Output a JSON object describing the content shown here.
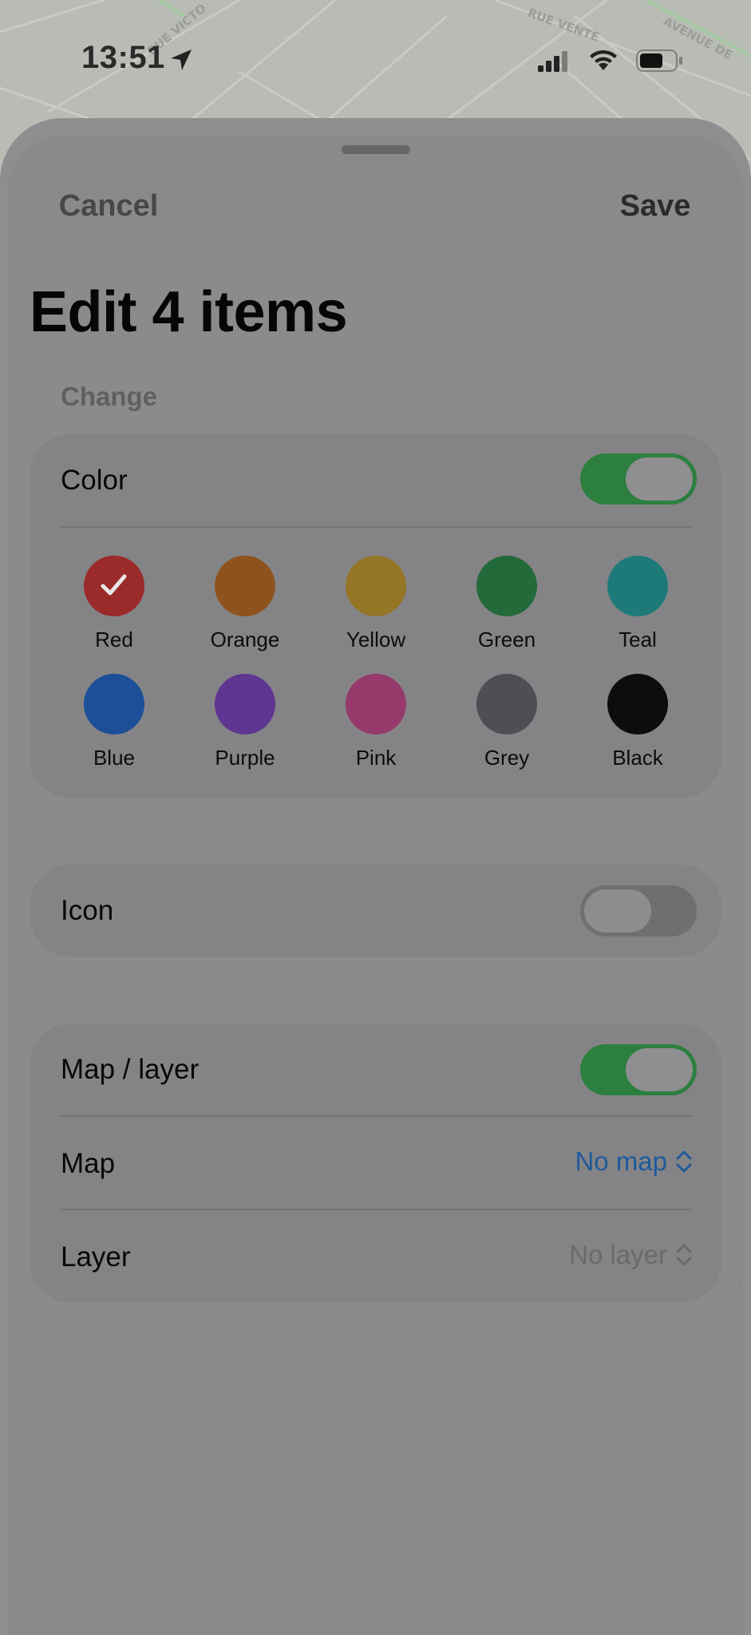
{
  "status_bar": {
    "time": "13:51",
    "icons": [
      "location-arrow-icon",
      "cellular-signal-icon",
      "wifi-icon",
      "battery-icon"
    ]
  },
  "background_map": {
    "street_labels": [
      "RUE VICTO",
      "RUE VENTE",
      "AVENUE DE"
    ]
  },
  "header": {
    "cancel_label": "Cancel",
    "save_label": "Save",
    "title": "Edit 4 items"
  },
  "change_section": {
    "header": "Change",
    "color": {
      "label": "Color",
      "enabled": true,
      "selected": "Red",
      "swatches": [
        {
          "name": "Red",
          "hex": "#9b2a2a"
        },
        {
          "name": "Orange",
          "hex": "#8e521e"
        },
        {
          "name": "Yellow",
          "hex": "#957526"
        },
        {
          "name": "Green",
          "hex": "#236a3a"
        },
        {
          "name": "Teal",
          "hex": "#1e7a78"
        },
        {
          "name": "Blue",
          "hex": "#1d4e98"
        },
        {
          "name": "Purple",
          "hex": "#5f3592"
        },
        {
          "name": "Pink",
          "hex": "#963a6b"
        },
        {
          "name": "Grey",
          "hex": "#4e4f55"
        },
        {
          "name": "Black",
          "hex": "#0d0d0f"
        }
      ]
    },
    "icon": {
      "label": "Icon",
      "enabled": false
    },
    "map_layer": {
      "label": "Map / layer",
      "enabled": true,
      "map_label": "Map",
      "map_value": "No map",
      "layer_label": "Layer",
      "layer_value": "No layer"
    }
  },
  "colors": {
    "toggle_on": "#2d7f3f",
    "picker_accent": "#1f5a9a"
  }
}
